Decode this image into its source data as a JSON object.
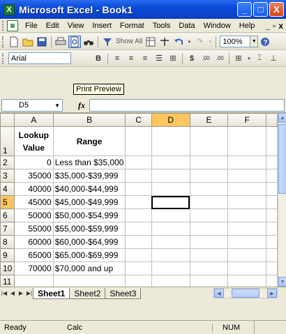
{
  "window": {
    "title": "Microsoft Excel - Book1",
    "app_icon_glyph": "X",
    "buttons": [
      "_",
      "□",
      "X"
    ]
  },
  "menu": {
    "items": [
      "File",
      "Edit",
      "View",
      "Insert",
      "Format",
      "Tools",
      "Data",
      "Window",
      "Help"
    ],
    "mdi_minimize": "_",
    "mdi_restore": "▫",
    "mdi_close": "x"
  },
  "toolbar_standard": {
    "show_all_label": "Show All",
    "zoom": "100%"
  },
  "toolbar_formatting": {
    "font": "Arial",
    "currency": "$",
    "inc_decimal": ".00",
    "dec_decimal": ".00"
  },
  "tooltip": "Print Preview",
  "formula_bar": {
    "name_box": "D5",
    "fx": "fx",
    "content": ""
  },
  "sheet": {
    "columns": [
      "A",
      "B",
      "C",
      "D",
      "E",
      "F"
    ],
    "header_row": {
      "a": "Lookup Value",
      "b": "Range"
    },
    "rows": [
      {
        "num": "1"
      },
      {
        "num": "2",
        "a": "0",
        "b": "Less than $35,000"
      },
      {
        "num": "3",
        "a": "35000",
        "b": "$35,000-$39,999"
      },
      {
        "num": "4",
        "a": "40000",
        "b": "$40,000-$44,999"
      },
      {
        "num": "5",
        "a": "45000",
        "b": "$45,000-$49,999"
      },
      {
        "num": "6",
        "a": "50000",
        "b": "$50,000-$54,999"
      },
      {
        "num": "7",
        "a": "55000",
        "b": "$55,000-$59,999"
      },
      {
        "num": "8",
        "a": "60000",
        "b": "$60,000-$64,999"
      },
      {
        "num": "9",
        "a": "65000",
        "b": "$65,000-$69,999"
      },
      {
        "num": "10",
        "a": "70000",
        "b": "$70,000 and up"
      },
      {
        "num": "11"
      }
    ],
    "active_cell": "D5"
  },
  "tabs": [
    "Sheet1",
    "Sheet2",
    "Sheet3"
  ],
  "status": {
    "ready": "Ready",
    "calc": "Calc",
    "num": "NUM"
  }
}
